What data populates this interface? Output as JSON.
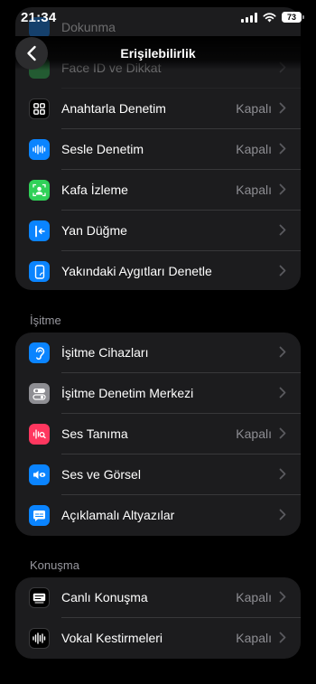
{
  "status": {
    "time": "21:34",
    "battery": "73"
  },
  "nav": {
    "title": "Erişilebilirlik"
  },
  "top_group": {
    "items": [
      {
        "label": "Dokunma"
      },
      {
        "label": "Face ID ve Dikkat"
      },
      {
        "label": "Anahtarla Denetim",
        "value": "Kapalı"
      },
      {
        "label": "Sesle Denetim",
        "value": "Kapalı"
      },
      {
        "label": "Kafa İzleme",
        "value": "Kapalı"
      },
      {
        "label": "Yan Düğme"
      },
      {
        "label": "Yakındaki Aygıtları Denetle"
      }
    ]
  },
  "hearing": {
    "header": "İşitme",
    "items": [
      {
        "label": "İşitme Cihazları"
      },
      {
        "label": "İşitme Denetim Merkezi"
      },
      {
        "label": "Ses Tanıma",
        "value": "Kapalı"
      },
      {
        "label": "Ses ve Görsel"
      },
      {
        "label": "Açıklamalı Altyazılar"
      }
    ]
  },
  "speech": {
    "header": "Konuşma",
    "items": [
      {
        "label": "Canlı Konuşma",
        "value": "Kapalı"
      },
      {
        "label": "Vokal Kestirmeleri",
        "value": "Kapalı"
      }
    ]
  },
  "colors": {
    "background": "#000000",
    "group_bg": "#1c1c1e",
    "secondary_text": "#8e8e93",
    "blue_icon": "#0a84ff",
    "green_icon": "#30d158",
    "pink_icon": "#ff375f",
    "gray_icon": "#8e8e93"
  },
  "icons": {
    "switch_control": "grid-icon",
    "voice_control": "waveform-icon",
    "head_tracking": "person-face-icon",
    "side_button": "side-button-icon",
    "nearby_devices": "phone-icon",
    "hearing_devices": "ear-icon",
    "hearing_control": "toggles-icon",
    "sound_recognition": "sound-recognition-icon",
    "audio_visual": "eye-speaker-icon",
    "captions": "captions-icon",
    "live_speech": "keyboard-icon",
    "vocal_shortcuts": "waveform-icon"
  }
}
